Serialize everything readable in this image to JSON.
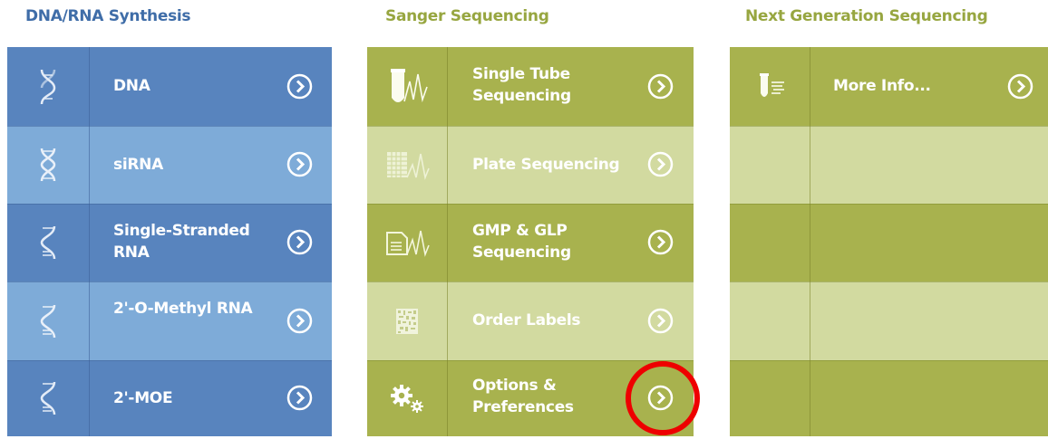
{
  "columns": [
    {
      "title": "DNA/RNA Synthesis",
      "rows": [
        {
          "label": "DNA",
          "icon": "dna-double-helix-icon"
        },
        {
          "label": "siRNA",
          "icon": "sirna-helix-icon"
        },
        {
          "label": "Single-Stranded RNA",
          "icon": "single-strand-icon"
        },
        {
          "label": "2'-O-Methyl RNA",
          "icon": "single-strand-icon"
        },
        {
          "label": "2'-MOE",
          "icon": "single-strand-icon"
        }
      ]
    },
    {
      "title": "Sanger Sequencing",
      "rows": [
        {
          "label": "Single Tube Sequencing",
          "icon": "tube-chromatogram-icon"
        },
        {
          "label": "Plate Sequencing",
          "icon": "plate-chromatogram-icon"
        },
        {
          "label": "GMP & GLP Sequencing",
          "icon": "document-chromatogram-icon"
        },
        {
          "label": "Order Labels",
          "icon": "barcode-label-icon"
        },
        {
          "label": "Options & Preferences",
          "icon": "gears-icon"
        }
      ]
    },
    {
      "title": "Next Generation Sequencing",
      "rows": [
        {
          "label": "More Info...",
          "icon": "tube-reads-icon"
        }
      ]
    }
  ],
  "colors": {
    "blue_title": "#3f6da8",
    "blue_dark": "#5884be",
    "blue_light": "#7eabd8",
    "green_title": "#97a640",
    "green_dark": "#a8b24e",
    "green_light": "#d2daa0",
    "highlight_circle": "#ee0000"
  }
}
